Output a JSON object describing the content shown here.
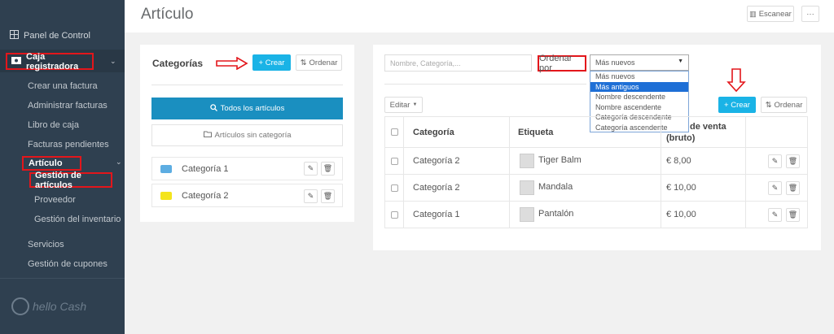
{
  "sidebar": {
    "dashboard": "Panel de Control",
    "cash_register": "Caja registradora",
    "items": [
      "Crear una factura",
      "Administrar facturas",
      "Libro de caja",
      "Facturas pendientes"
    ],
    "article": "Artículo",
    "article_items": [
      "Gestión de artículos",
      "Proveedor",
      "Gestión del inventario"
    ],
    "services": "Servicios",
    "coupons": "Gestión de cupones",
    "logo_text": "hello Cash"
  },
  "header": {
    "title": "Artículo",
    "scan_label": "Escanear",
    "more_label": "···"
  },
  "categories": {
    "title": "Categorías",
    "create_label": "+ Crear",
    "sort_label": "Ordenar",
    "all_articles": "Todos los artículos",
    "uncategorized": "Artículos sin categoría",
    "list": [
      {
        "name": "Categoría 1",
        "color": "#5dade2"
      },
      {
        "name": "Categoría 2",
        "color": "#f4e41c"
      }
    ]
  },
  "articles": {
    "search_placeholder": "Nombre, Categoría,...",
    "sort_by_label": "Ordenar por",
    "sort_selected": "Más nuevos",
    "sort_options": [
      "Más nuevos",
      "Más antiguos",
      "Nombre descendente",
      "Nombre ascendente",
      "Categoría descendente",
      "Categoría ascendente"
    ],
    "sort_highlighted_index": 1,
    "edit_label": "Editar",
    "create_label": "+ Crear",
    "sort_label": "Ordenar",
    "columns": [
      "Categoría",
      "Etiqueta",
      "de venta",
      "(bruto)"
    ],
    "rows": [
      {
        "category": "Categoría 2",
        "label": "Tiger Balm",
        "price": "€ 8,00"
      },
      {
        "category": "Categoría 2",
        "label": "Mandala",
        "price": "€ 10,00"
      },
      {
        "category": "Categoría 1",
        "label": "Pantalón",
        "price": "€ 10,00"
      }
    ]
  },
  "colors": {
    "sidebar": "#2f4050",
    "primary": "#1ab3e6",
    "highlight": "#e3161b"
  }
}
